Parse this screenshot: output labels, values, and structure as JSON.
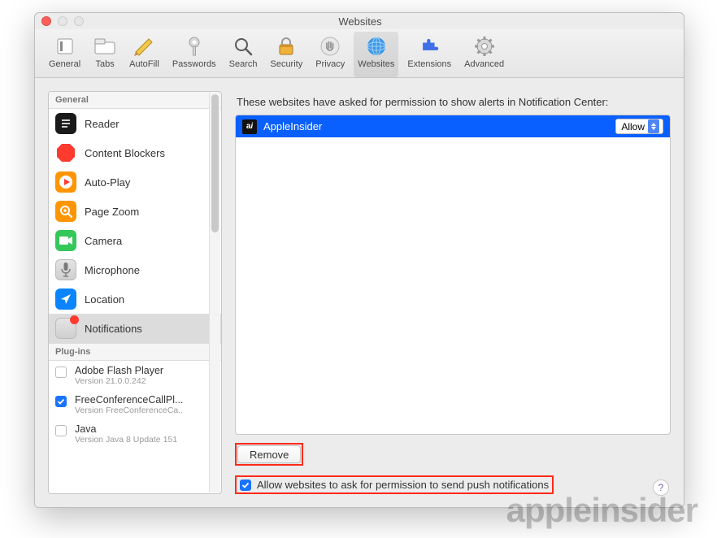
{
  "window": {
    "title": "Websites"
  },
  "toolbar": [
    {
      "id": "general",
      "label": "General"
    },
    {
      "id": "tabs",
      "label": "Tabs"
    },
    {
      "id": "autofill",
      "label": "AutoFill"
    },
    {
      "id": "passwords",
      "label": "Passwords"
    },
    {
      "id": "search",
      "label": "Search"
    },
    {
      "id": "security",
      "label": "Security"
    },
    {
      "id": "privacy",
      "label": "Privacy"
    },
    {
      "id": "websites",
      "label": "Websites"
    },
    {
      "id": "extensions",
      "label": "Extensions"
    },
    {
      "id": "advanced",
      "label": "Advanced"
    }
  ],
  "sidebar": {
    "header_general": "General",
    "header_plugins": "Plug-ins",
    "items": [
      {
        "label": "Reader"
      },
      {
        "label": "Content Blockers"
      },
      {
        "label": "Auto-Play"
      },
      {
        "label": "Page Zoom"
      },
      {
        "label": "Camera"
      },
      {
        "label": "Microphone"
      },
      {
        "label": "Location"
      },
      {
        "label": "Notifications"
      }
    ],
    "plugins": [
      {
        "name": "Adobe Flash Player",
        "version": "Version 21.0.0.242",
        "checked": false
      },
      {
        "name": "FreeConferenceCallPl...",
        "version": "Version FreeConferenceCa..",
        "checked": true
      },
      {
        "name": "Java",
        "version": "Version Java 8 Update 151",
        "checked": false
      }
    ]
  },
  "main": {
    "description": "These websites have asked for permission to show alerts in Notification Center:",
    "rows": [
      {
        "site": "AppleInsider",
        "permission": "Allow"
      }
    ],
    "remove_label": "Remove",
    "allow_checkbox_label": "Allow websites to ask for permission to send push notifications",
    "help_symbol": "?"
  },
  "watermark": "appleinsider"
}
